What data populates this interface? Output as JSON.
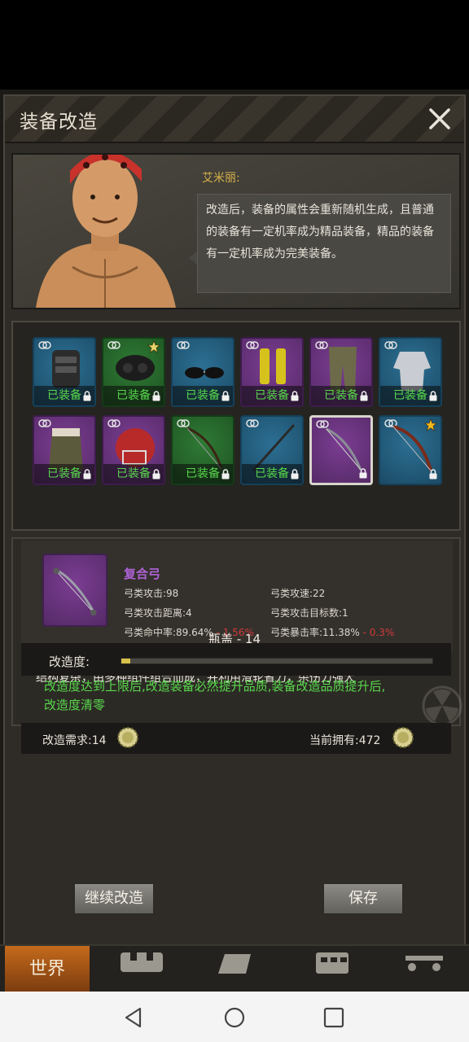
{
  "dialog": {
    "title": "装备改造"
  },
  "npc": {
    "name": "艾米丽:",
    "speech": "改造后，装备的属性会重新随机生成，且普通的装备有一定机率成为精品装备，精品的装备有一定机率成为完美装备。"
  },
  "equipped_label": "已装备",
  "inventory": [
    {
      "rarity": "blue",
      "item_icon": "tactical-vest-icon",
      "equipped": true,
      "starred": false
    },
    {
      "rarity": "green",
      "item_icon": "gas-mask-icon",
      "equipped": true,
      "starred": true,
      "star_color": "#e8d36a"
    },
    {
      "rarity": "blue",
      "item_icon": "sunglasses-icon",
      "equipped": true,
      "starred": false
    },
    {
      "rarity": "purple",
      "item_icon": "yellow-boots-icon",
      "equipped": true,
      "starred": false
    },
    {
      "rarity": "purple",
      "item_icon": "camo-pants-icon",
      "equipped": true,
      "starred": false
    },
    {
      "rarity": "blue",
      "item_icon": "shirt-icon",
      "equipped": true,
      "starred": false
    },
    {
      "rarity": "purple",
      "item_icon": "fur-coat-icon",
      "equipped": true,
      "starred": false
    },
    {
      "rarity": "purple",
      "item_icon": "football-helmet-icon",
      "equipped": true,
      "starred": false
    },
    {
      "rarity": "green",
      "item_icon": "bow-icon",
      "equipped": true,
      "starred": false
    },
    {
      "rarity": "blue",
      "item_icon": "stick-icon",
      "equipped": true,
      "starred": false
    },
    {
      "rarity": "purple",
      "item_icon": "compound-bow-icon",
      "equipped": false,
      "starred": false,
      "selected": true
    },
    {
      "rarity": "blue",
      "item_icon": "recurve-bow-icon",
      "equipped": false,
      "starred": true,
      "star_color": "#f2b820"
    }
  ],
  "item": {
    "name": "复合弓",
    "stats": [
      {
        "label": "弓类攻击:98",
        "delta": ""
      },
      {
        "label": "弓类攻速:22",
        "delta": ""
      },
      {
        "label": "弓类攻击距离:4",
        "delta": ""
      },
      {
        "label": "弓类攻击目标数:1",
        "delta": ""
      },
      {
        "label": "弓类命中率:89.64%",
        "delta": "- 1.56%"
      },
      {
        "label": "弓类暴击率:11.38%",
        "delta": "- 0.3%"
      }
    ],
    "description": "结构复杂，由多种组件组合而成，并利用滑轮省力，杀伤力强大"
  },
  "modify": {
    "cap_label": "瓶盖 - 14",
    "progress_label": "改造度:",
    "progress_fraction": 0.03,
    "hint": "改造度达到上限后,改造装备必然提升品质,装备改造品质提升后,改造度清零",
    "cost_label": "改造需求:14",
    "own_label": "当前拥有:472"
  },
  "buttons": {
    "continue": "继续改造",
    "save": "保存"
  },
  "game_nav": {
    "world": "世界"
  },
  "colors": {
    "equipped_text": "#58d84b",
    "item_name": "#b062d6",
    "negative_delta": "#d03a3a",
    "npc_name": "#d9b24a"
  }
}
